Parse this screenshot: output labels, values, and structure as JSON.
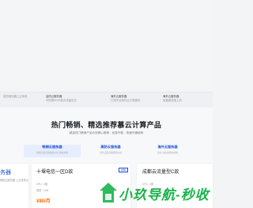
{
  "strip": [
    {
      "title": "高防云服务器",
      "sub": "可防御800G超大流量攻击"
    },
    {
      "title": "海外云服务器",
      "sub": "打造专业海外云计算服务"
    },
    {
      "title": "海外云服务器",
      "sub": "免备案快速上线"
    }
  ],
  "strip_left": "高防服务器上云体验",
  "section": {
    "title": "热门畅销、精选推荐慕云计算产品",
    "subtitle": "精选热门畅销产品为您精心推荐，优惠不断，快速开通使用"
  },
  "tabs": [
    {
      "label": "畅销云服务器",
      "sub": "畅销云服务器超低价格 限时抢购"
    },
    {
      "label": "高防云服务器",
      "sub": "高防云服务器超低价格"
    },
    {
      "label": "海外云服务器",
      "sub": "海外 免备案限时抢购"
    }
  ],
  "cards": [
    {
      "name": "务器",
      "spec": "畅销云服务器 上云抢低价",
      "price": ""
    },
    {
      "name": "十堰电信一区D款",
      "badge": "抢购",
      "spec1": "CPU : 4核",
      "spec2": "带宽 : 10M",
      "price": "¥80/月"
    },
    {
      "name": "成都云流量型C款",
      "spec1": "CPU : 2核",
      "spec2": "带宽 : 20M",
      "price": ""
    }
  ],
  "watermark": "小玖导航-秒收",
  "colors": {
    "accent": "#1d4fd6",
    "price": "#ff6a00",
    "watermark": "#19b44a"
  }
}
